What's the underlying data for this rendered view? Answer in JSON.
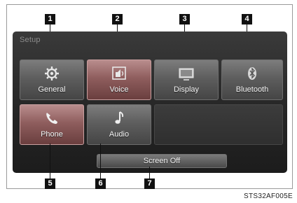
{
  "screen": {
    "title": "Setup",
    "tiles": [
      {
        "label": "General",
        "icon": "gear-icon"
      },
      {
        "label": "Voice",
        "icon": "voice-icon"
      },
      {
        "label": "Display",
        "icon": "display-icon"
      },
      {
        "label": "Bluetooth",
        "icon": "bluetooth-icon"
      },
      {
        "label": "Phone",
        "icon": "phone-icon"
      },
      {
        "label": "Audio",
        "icon": "music-note-icon"
      }
    ],
    "screen_off_label": "Screen Off",
    "colors": {
      "selected_tile": "#8f5e5e",
      "tile": "#5e5e5e",
      "background": "#262626"
    }
  },
  "callouts": [
    "1",
    "2",
    "3",
    "4",
    "5",
    "6",
    "7"
  ],
  "caption": "STS32AF005E"
}
